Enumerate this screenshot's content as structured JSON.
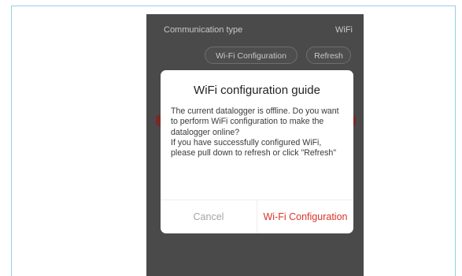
{
  "background_screen": {
    "communication_type_label": "Communication type",
    "communication_type_value": "WiFi",
    "wifi_configuration_button": "Wi-Fi Configuration",
    "refresh_button": "Refresh"
  },
  "dialog": {
    "title": "WiFi configuration guide",
    "message_line1": "The current datalogger is offline. Do you want to perform WiFi configuration to make the datalogger online?",
    "message_line2": "If you have successfully configured WiFi, please pull down to refresh or click \"Refresh\"",
    "cancel_label": "Cancel",
    "confirm_label": "Wi-Fi Configuration"
  },
  "colors": {
    "overlay": "#4a4a4a",
    "frame_border": "#93cfe6",
    "accent": "#d9342a",
    "cancel_text": "#a5a5a5"
  }
}
